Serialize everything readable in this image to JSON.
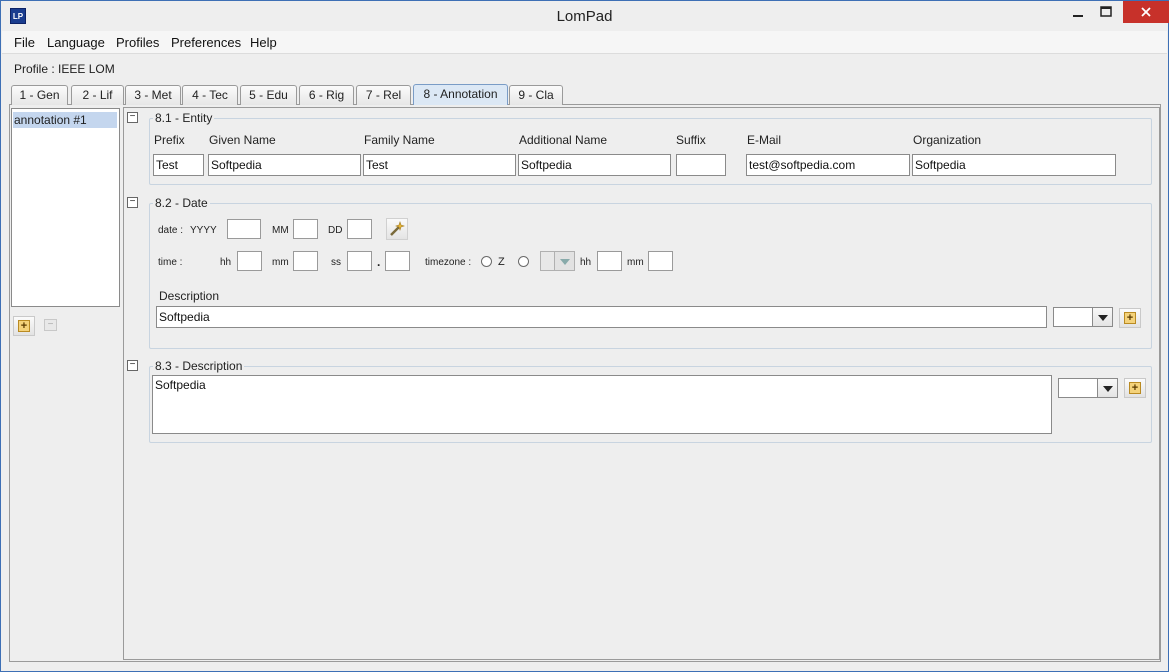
{
  "window": {
    "title": "LomPad",
    "icon": "lompad-logo-icon",
    "min_icon": "minimize-icon",
    "max_icon": "maximize-icon",
    "close_icon": "close-icon"
  },
  "menu": {
    "items": [
      "File",
      "Language",
      "Profiles",
      "Preferences",
      "Help"
    ]
  },
  "profile": {
    "label": "Profile : IEEE LOM"
  },
  "tabs": [
    {
      "label": "1 - Gen"
    },
    {
      "label": "2 - Lif"
    },
    {
      "label": "3 - Met"
    },
    {
      "label": "4 - Tec"
    },
    {
      "label": "5 - Edu"
    },
    {
      "label": "6 - Rig"
    },
    {
      "label": "7 - Rel"
    },
    {
      "label": "8 - Annotation",
      "active": true
    },
    {
      "label": "9 - Cla"
    }
  ],
  "annotations": {
    "items": [
      "annotation #1"
    ]
  },
  "entity": {
    "title": "8.1 - Entity",
    "collapse": "−",
    "columns": [
      "Prefix",
      "Given Name",
      "Family Name",
      "Additional Name",
      "Suffix",
      "E-Mail",
      "Organization"
    ],
    "values": {
      "prefix": "Test",
      "given_name": "Softpedia",
      "family_name": "Test",
      "additional_name": "Softpedia",
      "suffix": "",
      "email": "test@softpedia.com",
      "organization": "Softpedia"
    }
  },
  "date": {
    "title": "8.2 - Date",
    "collapse": "−",
    "date_label": "date :",
    "yyyy": "YYYY",
    "mm": "MM",
    "dd": "DD",
    "time_label": "time :",
    "hh": "hh",
    "min": "mm",
    "ss": "ss",
    "dot": ".",
    "timezone_label": "timezone :",
    "z_label": "Z",
    "tz_hh": "hh",
    "tz_mm": "mm",
    "description_label": "Description",
    "description_value": "Softpedia",
    "wand_icon": "magic-wand-icon"
  },
  "description": {
    "title": "8.3 - Description",
    "collapse": "−",
    "value": "Softpedia"
  },
  "icons": {
    "plus": "+",
    "minus": "−"
  },
  "colors": {
    "accent": "#4a7fc1",
    "close": "#c7312a",
    "selection": "#c4d6ee",
    "active_tab": "#dce8f5"
  }
}
